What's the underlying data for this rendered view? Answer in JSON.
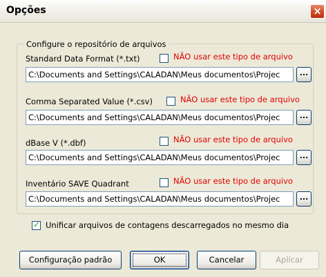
{
  "window": {
    "title": "Opções",
    "close_glyph": "×"
  },
  "group": {
    "legend": "Configure o repositório de arquivos"
  },
  "rows": [
    {
      "label": "Standard Data Format (*.txt)",
      "no_use_label": "NÃO usar este tipo de arquivo",
      "no_use_checked": false,
      "path": "C:\\Documents and Settings\\CALADAN\\Meus documentos\\Projec",
      "browse_label": "..."
    },
    {
      "label": "Comma Separated Value (*.csv)",
      "no_use_label": "NÃO usar este tipo de arquivo",
      "no_use_checked": false,
      "path": "C:\\Documents and Settings\\CALADAN\\Meus documentos\\Projec",
      "browse_label": "..."
    },
    {
      "label": "dBase V (*.dbf)",
      "no_use_label": "NÃO usar este tipo de arquivo",
      "no_use_checked": false,
      "path": "C:\\Documents and Settings\\CALADAN\\Meus documentos\\Projec",
      "browse_label": "..."
    },
    {
      "label": "Inventário SAVE Quadrant",
      "no_use_label": "NÃO usar este tipo de arquivo",
      "no_use_checked": false,
      "path": "C:\\Documents and Settings\\CALADAN\\Meus documentos\\Projec",
      "browse_label": "..."
    }
  ],
  "unify": {
    "label": "Unificar arquivos de contagens descarregados no mesmo dia",
    "checked": true
  },
  "buttons": {
    "default_config": "Configuração padrão",
    "ok": "OK",
    "cancel": "Cancelar",
    "apply": "Aplicar",
    "apply_enabled": false
  },
  "colors": {
    "dialog_bg": "#ece9d8",
    "warning_text": "#e00000",
    "close_button": "#d1421c",
    "field_border": "#7f9db9"
  }
}
